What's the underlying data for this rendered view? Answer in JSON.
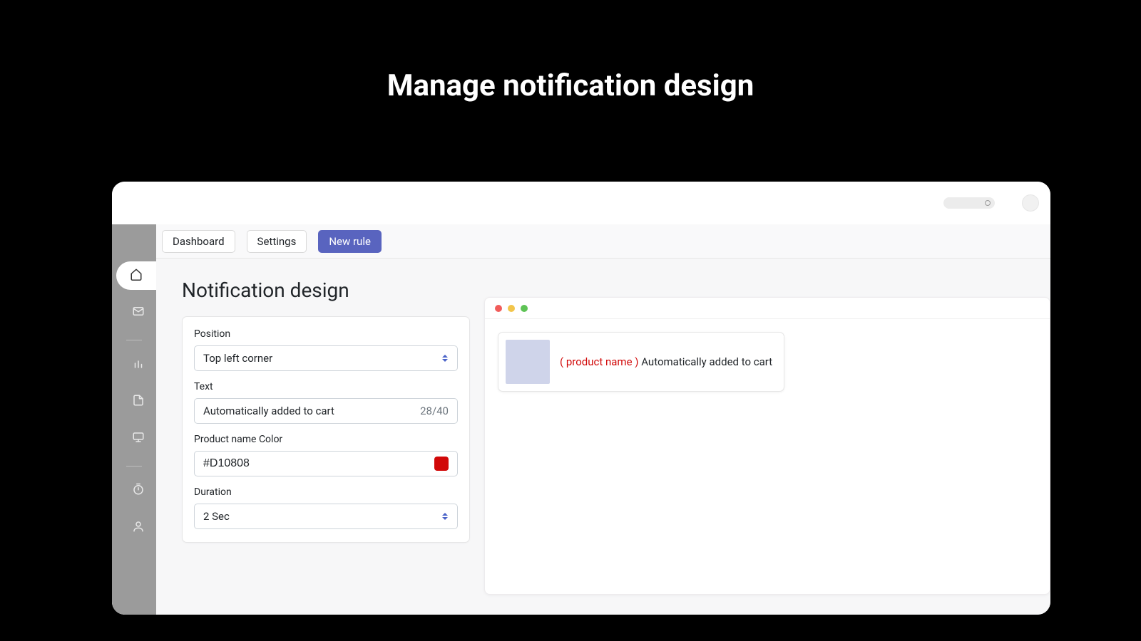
{
  "page_title": "Manage notification design",
  "tabs": {
    "dashboard": "Dashboard",
    "settings": "Settings",
    "new_rule": "New rule"
  },
  "section_title": "Notification design",
  "form": {
    "position": {
      "label": "Position",
      "value": "Top left corner"
    },
    "text": {
      "label": "Text",
      "value": "Automatically added to cart",
      "counter": "28/40"
    },
    "color": {
      "label": "Product name Color",
      "value": "#D10808"
    },
    "duration": {
      "label": "Duration",
      "value": "2 Sec"
    }
  },
  "preview": {
    "product_name_placeholder": "( product name )",
    "text": "Automatically added to cart"
  }
}
